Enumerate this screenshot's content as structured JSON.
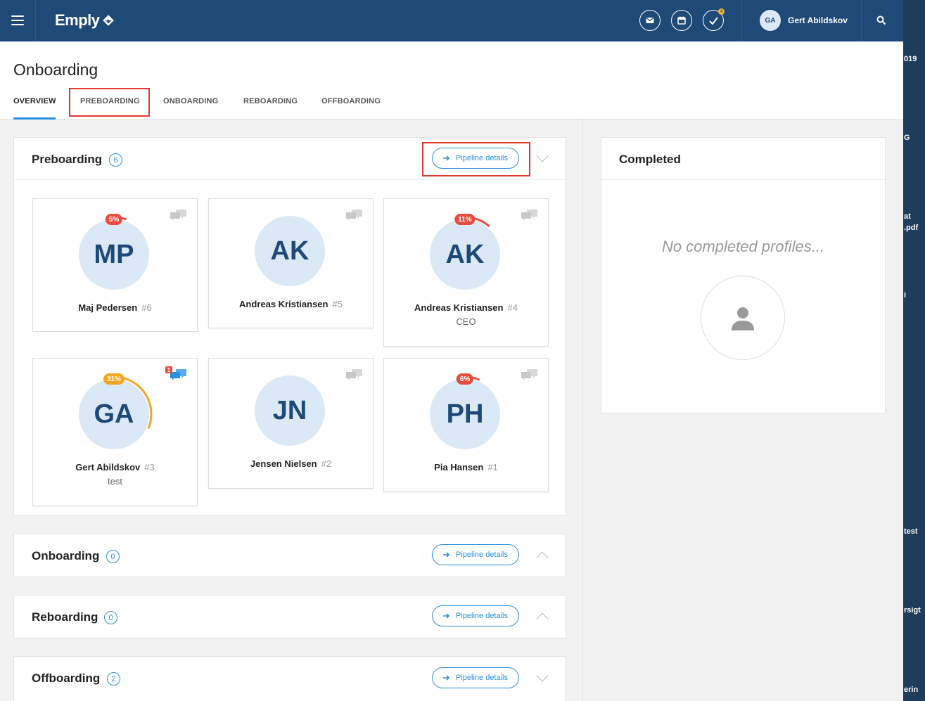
{
  "topbar": {
    "logo": "Emply",
    "tasks_badge": "4",
    "user_initials": "GA",
    "user_name": "Gert Abildskov"
  },
  "page": {
    "title": "Onboarding",
    "tabs": [
      {
        "label": "OVERVIEW",
        "active": true
      },
      {
        "label": "PREBOARDING",
        "active": false
      },
      {
        "label": "ONBOARDING",
        "active": false
      },
      {
        "label": "REBOARDING",
        "active": false
      },
      {
        "label": "OFFBOARDING",
        "active": false
      }
    ]
  },
  "pipeline_button_label": "Pipeline details",
  "sections": {
    "preboarding": {
      "title": "Preboarding",
      "count": "6",
      "cards": [
        {
          "initials": "MP",
          "name": "Maj Pedersen",
          "num": "#6",
          "subtitle": "",
          "progress": "5%",
          "progress_value": 0.05,
          "progress_color": "#e84c3d",
          "chat_badge": ""
        },
        {
          "initials": "AK",
          "name": "Andreas Kristiansen",
          "num": "#5",
          "subtitle": "",
          "progress": "",
          "progress_value": 0,
          "progress_color": "",
          "chat_badge": ""
        },
        {
          "initials": "AK",
          "name": "Andreas Kristiansen",
          "num": "#4",
          "subtitle": "CEO",
          "progress": "11%",
          "progress_value": 0.11,
          "progress_color": "#e84c3d",
          "chat_badge": ""
        },
        {
          "initials": "GA",
          "name": "Gert Abildskov",
          "num": "#3",
          "subtitle": "test",
          "progress": "31%",
          "progress_value": 0.31,
          "progress_color": "#f5a623",
          "chat_badge": "1"
        },
        {
          "initials": "JN",
          "name": "Jensen Nielsen",
          "num": "#2",
          "subtitle": "",
          "progress": "",
          "progress_value": 0,
          "progress_color": "",
          "chat_badge": ""
        },
        {
          "initials": "PH",
          "name": "Pia Hansen",
          "num": "#1",
          "subtitle": "",
          "progress": "6%",
          "progress_value": 0.06,
          "progress_color": "#e84c3d",
          "chat_badge": ""
        }
      ]
    },
    "onboarding": {
      "title": "Onboarding",
      "count": "0"
    },
    "reboarding": {
      "title": "Reboarding",
      "count": "0"
    },
    "offboarding": {
      "title": "Offboarding",
      "count": "2"
    }
  },
  "completed": {
    "title": "Completed",
    "empty_text": "No completed profiles..."
  },
  "desktop_fragments": [
    "019",
    "G",
    "at",
    ".pdf",
    "i",
    "test",
    "rsigt",
    "erin"
  ],
  "colors": {
    "topbar": "#1f4a78",
    "accent": "#2b8fe0",
    "highlight": "#e03a2f"
  }
}
